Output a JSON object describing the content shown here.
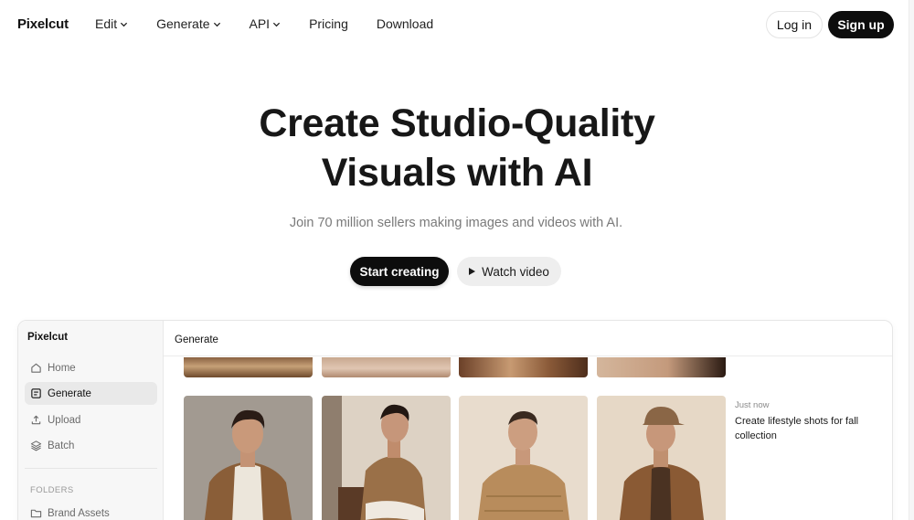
{
  "nav": {
    "logo": "Pixelcut",
    "links": [
      {
        "label": "Edit",
        "dropdown": true
      },
      {
        "label": "Generate",
        "dropdown": true
      },
      {
        "label": "API",
        "dropdown": true
      },
      {
        "label": "Pricing",
        "dropdown": false
      },
      {
        "label": "Download",
        "dropdown": false
      }
    ],
    "login": "Log in",
    "signup": "Sign up"
  },
  "hero": {
    "title_line1": "Create Studio-Quality",
    "title_line2": "Visuals with AI",
    "subtitle": "Join 70 million sellers making images and videos with AI.",
    "start_label": "Start creating",
    "watch_label": "Watch video"
  },
  "app": {
    "sidebar_title": "Pixelcut",
    "sidebar_items": [
      {
        "label": "Home",
        "icon": "home-icon",
        "active": false
      },
      {
        "label": "Generate",
        "icon": "generate-icon",
        "active": true
      },
      {
        "label": "Upload",
        "icon": "upload-icon",
        "active": false
      },
      {
        "label": "Batch",
        "icon": "layers-icon",
        "active": false
      }
    ],
    "folders_heading": "FOLDERS",
    "folders": [
      {
        "label": "Brand Assets",
        "icon": "folder-icon"
      }
    ],
    "main_title": "Generate",
    "generation": {
      "time": "Just now",
      "prompt": "Create lifestyle shots for fall collection"
    }
  },
  "colors": {
    "primary": "#0d0d0d",
    "muted_text": "#7a7a7a",
    "sidebar_bg": "#f7f7f7",
    "active_item_bg": "#e9e9e9"
  }
}
